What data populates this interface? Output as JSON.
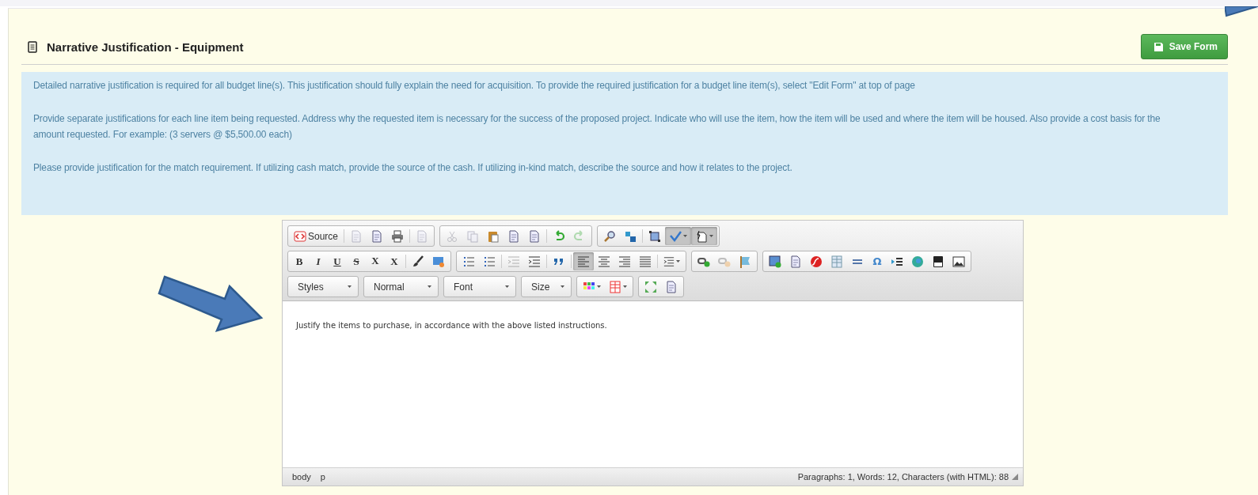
{
  "section": {
    "title": "Narrative Justification - Equipment",
    "save_button": "Save Form"
  },
  "instructions": [
    {
      "text": "Detailed narrative justification is required for all budget line(s). This justification should fully explain the need for acquisition. To provide the required justification for a budget line item(s), select \"Edit Form\" at top of page"
    },
    {
      "text": "Provide separate justifications for each line item being requested. Address why the requested item is necessary for the success of the proposed project. Indicate who will use the item, how the item will be used and where the item will be housed. Also provide a cost basis for the amount requested. For example: (3 servers @ $5,500.00 each)"
    },
    {
      "text": "Please provide justification for the match requirement. If utilizing cash match, provide the source of the cash. If utilizing in-kind match, describe the source and how it relates to the project."
    }
  ],
  "toolbar": [
    [
      [
        {
          "kind": "source",
          "label": "Source",
          "disabled": false,
          "pressed": false
        },
        {
          "kind": "sep"
        },
        {
          "kind": "newpage",
          "disabled": true,
          "pressed": false
        },
        {
          "kind": "preview",
          "disabled": false,
          "pressed": false
        },
        {
          "kind": "print",
          "disabled": false,
          "pressed": false
        },
        {
          "kind": "sep"
        },
        {
          "kind": "templates",
          "disabled": true,
          "pressed": false
        }
      ],
      [
        {
          "kind": "cut",
          "disabled": true,
          "pressed": false
        },
        {
          "kind": "copy",
          "disabled": true,
          "pressed": false
        },
        {
          "kind": "paste",
          "disabled": false,
          "pressed": false
        },
        {
          "kind": "pastetext",
          "disabled": false,
          "pressed": false
        },
        {
          "kind": "pasteword",
          "disabled": false,
          "pressed": false
        },
        {
          "kind": "sep"
        },
        {
          "kind": "undo",
          "disabled": false,
          "pressed": false
        },
        {
          "kind": "redo",
          "disabled": true,
          "pressed": false
        }
      ],
      [
        {
          "kind": "find",
          "disabled": false,
          "pressed": false
        },
        {
          "kind": "replace",
          "disabled": false,
          "pressed": false
        },
        {
          "kind": "sep"
        },
        {
          "kind": "selectall",
          "disabled": false,
          "pressed": false
        },
        {
          "kind": "spellcheck",
          "disabled": false,
          "pressed": true,
          "dropdown": true
        },
        {
          "kind": "format",
          "disabled": false,
          "pressed": true,
          "dropdown": true
        }
      ]
    ],
    [
      [
        {
          "kind": "bold",
          "label": "B",
          "disabled": false,
          "pressed": false
        },
        {
          "kind": "italic",
          "label": "I",
          "disabled": false,
          "pressed": false
        },
        {
          "kind": "underline",
          "label": "U",
          "disabled": false,
          "pressed": false
        },
        {
          "kind": "strike",
          "label": "S",
          "disabled": false,
          "pressed": false
        },
        {
          "kind": "subscript",
          "label": "X",
          "disabled": false,
          "pressed": false
        },
        {
          "kind": "superscript",
          "label": "X",
          "disabled": false,
          "pressed": false
        },
        {
          "kind": "sep"
        },
        {
          "kind": "brush",
          "disabled": false,
          "pressed": false
        },
        {
          "kind": "removeformat",
          "disabled": false,
          "pressed": false
        }
      ],
      [
        {
          "kind": "numlist",
          "disabled": false,
          "pressed": false
        },
        {
          "kind": "bulletlist",
          "disabled": false,
          "pressed": false
        },
        {
          "kind": "sep"
        },
        {
          "kind": "outdent",
          "disabled": true,
          "pressed": false
        },
        {
          "kind": "indent",
          "disabled": false,
          "pressed": false
        },
        {
          "kind": "sep"
        },
        {
          "kind": "quote",
          "disabled": false,
          "pressed": false
        },
        {
          "kind": "sep"
        },
        {
          "kind": "alignleft",
          "disabled": false,
          "pressed": true
        },
        {
          "kind": "aligncenter",
          "disabled": false,
          "pressed": false
        },
        {
          "kind": "alignright",
          "disabled": false,
          "pressed": false
        },
        {
          "kind": "justify",
          "disabled": false,
          "pressed": false
        },
        {
          "kind": "sep"
        },
        {
          "kind": "language",
          "disabled": false,
          "pressed": false,
          "dropdown": true
        }
      ],
      [
        {
          "kind": "link",
          "disabled": false,
          "pressed": false
        },
        {
          "kind": "unlink",
          "disabled": true,
          "pressed": false
        },
        {
          "kind": "anchor",
          "disabled": false,
          "pressed": false
        }
      ],
      [
        {
          "kind": "image",
          "disabled": false,
          "pressed": false
        },
        {
          "kind": "div",
          "disabled": false,
          "pressed": false
        },
        {
          "kind": "flash",
          "disabled": false,
          "pressed": false
        },
        {
          "kind": "table",
          "disabled": false,
          "pressed": false
        },
        {
          "kind": "hr",
          "disabled": false,
          "pressed": false
        },
        {
          "kind": "char",
          "label": "Ω",
          "disabled": false,
          "pressed": false
        },
        {
          "kind": "pagebreak",
          "disabled": false,
          "pressed": false
        },
        {
          "kind": "globe",
          "disabled": false,
          "pressed": false
        },
        {
          "kind": "youtube",
          "disabled": false,
          "pressed": false
        },
        {
          "kind": "picture",
          "disabled": false,
          "pressed": false
        }
      ]
    ]
  ],
  "combos": [
    "Styles",
    "Normal",
    "Font",
    "Size"
  ],
  "extra_tools": [
    [
      {
        "kind": "colors",
        "disabled": false,
        "pressed": false,
        "dropdown": true
      },
      {
        "kind": "grid",
        "disabled": false,
        "pressed": false,
        "dropdown": true
      }
    ],
    [
      {
        "kind": "maximize",
        "disabled": false,
        "pressed": false
      },
      {
        "kind": "blocks",
        "disabled": false,
        "pressed": false
      }
    ]
  ],
  "editor": {
    "content": "Justify the items to purchase, in accordance with the above listed instructions."
  },
  "status_bar": {
    "path": [
      "body",
      "p"
    ],
    "counts": "Paragraphs: 1, Words: 12, Characters (with HTML): 88"
  }
}
